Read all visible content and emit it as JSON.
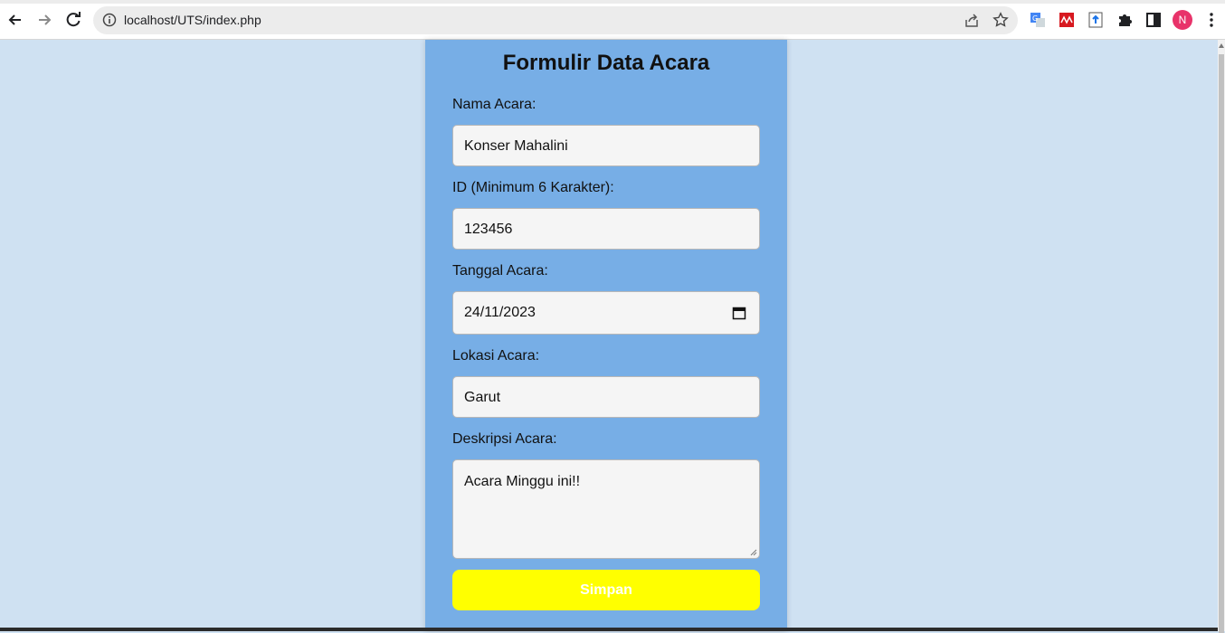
{
  "browser": {
    "url": "localhost/UTS/index.php",
    "profile_initial": "N",
    "icons": [
      "back-icon",
      "forward-icon",
      "reload-icon",
      "info-icon",
      "share-icon",
      "star-icon",
      "translate-icon",
      "mendeley-icon",
      "extension-icon",
      "puzzle-icon",
      "sidepanel-icon",
      "menu-icon"
    ],
    "accent_colors": {
      "avatar": "#e8336a"
    }
  },
  "form": {
    "title": "Formulir Data Acara",
    "nama_label": "Nama Acara:",
    "nama_value": "Konser Mahalini",
    "id_label": "ID (Minimum 6 Karakter):",
    "id_value": "123456",
    "tanggal_label": "Tanggal Acara:",
    "tanggal_value": "24/11/2023",
    "lokasi_label": "Lokasi Acara:",
    "lokasi_value": "Garut",
    "deskripsi_label": "Deskripsi Acara:",
    "deskripsi_value": "Acara Minggu ini!!",
    "save_label": "Simpan"
  },
  "colors": {
    "page_bg": "#cfe1f2",
    "card_bg": "#77aee6",
    "button_bg": "#ffff00",
    "button_text": "#ffffff"
  }
}
